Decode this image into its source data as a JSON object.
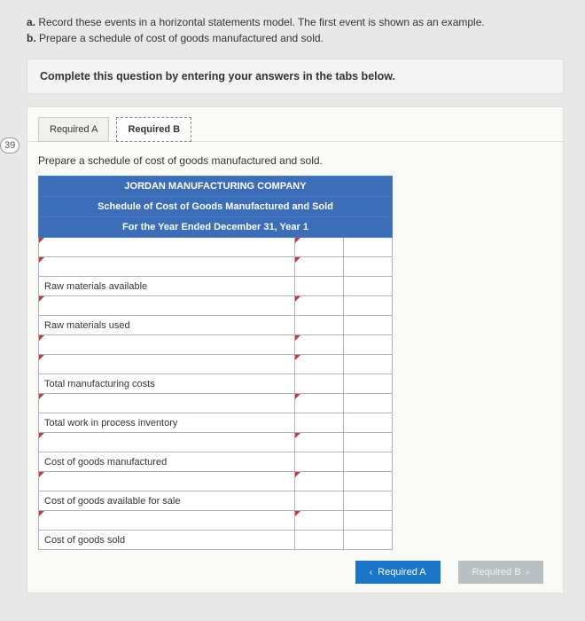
{
  "badge": "39",
  "questions": [
    {
      "label": "a.",
      "text": "Record these events in a horizontal statements model. The first event is shown as an example."
    },
    {
      "label": "b.",
      "text": "Prepare a schedule of cost of goods manufactured and sold."
    }
  ],
  "instruction": "Complete this question by entering your answers in the tabs below.",
  "tabs": {
    "a": "Required A",
    "b": "Required B"
  },
  "panel": {
    "desc": "Prepare a schedule of cost of goods manufactured and sold.",
    "header1": "JORDAN MANUFACTURING COMPANY",
    "header2": "Schedule of Cost of Goods Manufactured and Sold",
    "header3": "For the Year Ended December 31, Year 1",
    "rows": [
      "",
      "",
      "Raw materials available",
      "",
      "Raw materials used",
      "",
      "",
      "Total manufacturing costs",
      "",
      "Total work in process inventory",
      "",
      "Cost of goods manufactured",
      "",
      "Cost of goods available for sale",
      "",
      "Cost of goods sold"
    ]
  },
  "nav": {
    "prev": "Required A",
    "next": "Required B"
  }
}
